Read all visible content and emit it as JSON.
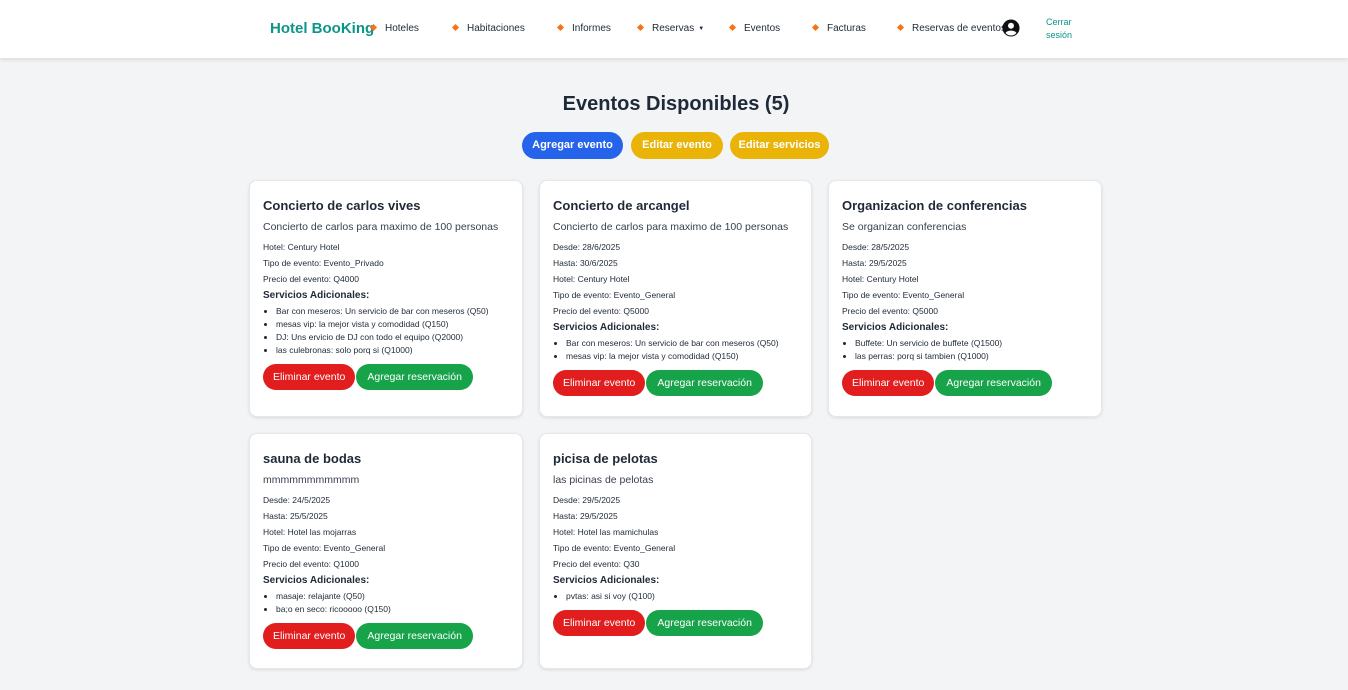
{
  "nav": {
    "brand": "Hotel BooKing",
    "items": [
      {
        "label": "Hoteles"
      },
      {
        "label": "Habitaciones"
      },
      {
        "label": "Informes"
      },
      {
        "label": "Reservas"
      },
      {
        "label": "Eventos"
      },
      {
        "label": "Facturas"
      },
      {
        "label": "Reservas de eventos"
      }
    ],
    "logout_line1": "Cerrar",
    "logout_line2": "sesión"
  },
  "page_title": "Eventos Disponibles (5)",
  "toolbar": {
    "add_label": "Agregar evento",
    "edit_label": "Editar evento",
    "edit_services_label": "Editar servicios"
  },
  "labels": {
    "hotel": "Hotel: ",
    "desde": "Desde: ",
    "hasta": "Hasta: ",
    "tipo": "Tipo de evento: ",
    "precio": "Precio del evento: ",
    "servicios": "Servicios Adicionales:",
    "delete": "Eliminar evento",
    "reserve": "Agregar reservación"
  },
  "events": [
    {
      "title": "Concierto de carlos vives",
      "description": "Concierto de carlos para maximo de 100 personas",
      "hotel": "Century Hotel",
      "tipo": "Evento_Privado",
      "precio": "Q4000",
      "services": [
        {
          "name": "Bar con meseros",
          "desc": "Un servicio de bar con meseros (Q50)"
        },
        {
          "name": "mesas vip",
          "desc": "la mejor vista y comodidad (Q150)"
        },
        {
          "name": "DJ",
          "desc": "Uns ervicio de DJ con todo el equipo (Q2000)"
        },
        {
          "name": "las culebronas",
          "desc": "solo porq si (Q1000)"
        }
      ]
    },
    {
      "title": "Concierto de arcangel",
      "description": "Concierto de carlos para maximo de 100 personas",
      "desde": "28/6/2025",
      "hasta": "30/6/2025",
      "hotel": "Century Hotel",
      "tipo": "Evento_General",
      "precio": "Q5000",
      "services": [
        {
          "name": "Bar con meseros",
          "desc": "Un servicio de bar con meseros (Q50)"
        },
        {
          "name": "mesas vip",
          "desc": "la mejor vista y comodidad (Q150)"
        }
      ]
    },
    {
      "title": "Organizacion de conferencias",
      "description": "Se organizan conferencias",
      "desde": "28/5/2025",
      "hasta": "29/5/2025",
      "hotel": "Century Hotel",
      "tipo": "Evento_General",
      "precio": "Q5000",
      "services": [
        {
          "name": "Buffete",
          "desc": "Un servicio de buffete (Q1500)"
        },
        {
          "name": "las perras",
          "desc": "porq si tambien (Q1000)"
        }
      ]
    },
    {
      "title": "sauna de bodas",
      "description": "mmmmmmmmmmm",
      "desde": "24/5/2025",
      "hasta": "25/5/2025",
      "hotel": "Hotel las mojarras",
      "tipo": "Evento_General",
      "precio": "Q1000",
      "services": [
        {
          "name": "masaje",
          "desc": "relajante (Q50)"
        },
        {
          "name": "ba;o en seco",
          "desc": "ricooooo (Q150)"
        }
      ]
    },
    {
      "title": "picisa de pelotas",
      "description": "las picinas de pelotas",
      "desde": "29/5/2025",
      "hasta": "29/5/2025",
      "hotel": "Hotel las mamichulas",
      "tipo": "Evento_General",
      "precio": "Q30",
      "services": [
        {
          "name": "pvtas",
          "desc": "asi si voy (Q100)"
        }
      ]
    }
  ],
  "colors": {
    "brand": "#0d9488",
    "primary": "#2563eb",
    "warning": "#eab308",
    "danger": "#e11d1d",
    "success": "#16a34a",
    "bullet": "#f97316",
    "background": "#f3f4f6"
  }
}
